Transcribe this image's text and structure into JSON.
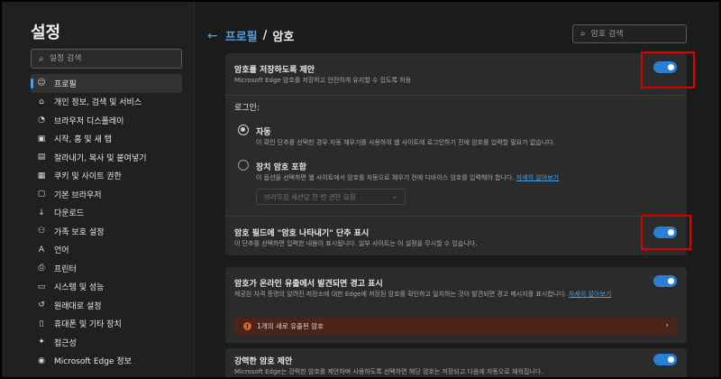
{
  "sidebar": {
    "title": "설정",
    "search_placeholder": "설정 검색",
    "items": [
      {
        "label": "프로필",
        "icon": "profile-icon",
        "glyph": "☺"
      },
      {
        "label": "개인 정보, 검색 및 서비스",
        "icon": "lock-icon",
        "glyph": "⌂"
      },
      {
        "label": "브라우저 디스플레이",
        "icon": "palette-icon",
        "glyph": "◔"
      },
      {
        "label": "시작, 홈 및 새 탭",
        "icon": "home-icon",
        "glyph": "▣"
      },
      {
        "label": "잘라내기, 복사 및 붙여넣기",
        "icon": "clipboard-icon",
        "glyph": "▤"
      },
      {
        "label": "쿠키 및 사이트 권한",
        "icon": "cookie-icon",
        "glyph": "▦"
      },
      {
        "label": "기본 브라우저",
        "icon": "browser-icon",
        "glyph": "▢"
      },
      {
        "label": "다운로드",
        "icon": "download-icon",
        "glyph": "↓"
      },
      {
        "label": "가족 보호 설정",
        "icon": "family-icon",
        "glyph": "⚇"
      },
      {
        "label": "언어",
        "icon": "language-icon",
        "glyph": "A"
      },
      {
        "label": "프린터",
        "icon": "printer-icon",
        "glyph": "⎙"
      },
      {
        "label": "시스템 및 성능",
        "icon": "system-icon",
        "glyph": "▭"
      },
      {
        "label": "원래대로 설정",
        "icon": "reset-icon",
        "glyph": "↺"
      },
      {
        "label": "휴대폰 및 기타 장치",
        "icon": "phone-icon",
        "glyph": "▯"
      },
      {
        "label": "접근성",
        "icon": "accessibility-icon",
        "glyph": "✦"
      },
      {
        "label": "Microsoft Edge 정보",
        "icon": "edge-icon",
        "glyph": "◉"
      }
    ]
  },
  "header": {
    "profile_link": "프로필",
    "separator": "/",
    "current": "암호",
    "search_placeholder": "암호 검색"
  },
  "offer_save": {
    "title": "암호를 저장하도록 제안",
    "desc": "Microsoft Edge 암호를 저장하고 안전하게 유지할 수 있도록 허용",
    "enabled": true
  },
  "signin": {
    "label": "로그인:",
    "auto_title": "자동",
    "auto_desc": "이 확인 단추를 선택한 경우 자동 채우기를 사용하여 웹 사이트에 로그인하기 전에 암호를 입력할 필요가 없습니다.",
    "device_title": "장치 암호 포함",
    "device_desc": "이 옵션을 선택하면 웹 사이트에서 암호를 자동으로 채우기 전에 디바이스 암호를 입력해야 합니다.",
    "device_link": "자세히 알아보기",
    "select_value": "브라우징 세션당 한 번 권한 요청"
  },
  "reveal": {
    "title": "암호 필드에 \"암호 나타내기\" 단추 표시",
    "desc": "이 단추를 선택하면 입력한 내용이 표시됩니다. 일부 사이트는 이 설정을 무시할 수 있습니다.",
    "enabled": true
  },
  "leak": {
    "title": "암호가 온라인 유출에서 발견되면 경고 표시",
    "desc": "제공된 자격 증명의 알려진 저장소에 대한 Edge에 저장된 암호를 확인하고 일치하는 것이 발견되면 경고 메시지를 표시합니다.",
    "link_part1": "자세히",
    "link_part2": "알아보기",
    "enabled": true,
    "alert_text": "1개의 새로 유출된 암호"
  },
  "strong": {
    "title": "강력한 암호 제안",
    "desc": "Microsoft Edge는 강력한 암호를 제안하며 사용하도록 선택하면 해당 암호는 저장되고 다음에 자동으로 채워집니다.",
    "enabled": true
  },
  "colors": {
    "accent": "#2a7fd4",
    "highlight": "#e00000",
    "alert_bg": "#4a2418"
  }
}
